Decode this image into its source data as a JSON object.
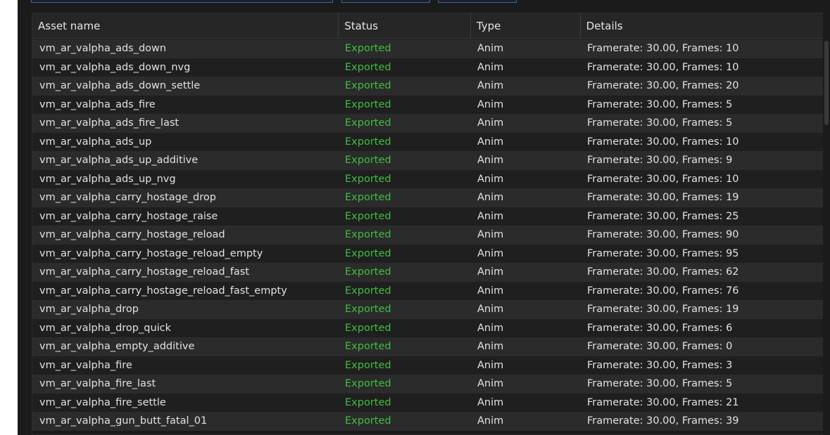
{
  "table": {
    "columns": [
      "Asset name",
      "Status",
      "Type",
      "Details"
    ],
    "rows": [
      {
        "name": "vm_ar_valpha_ads_down",
        "status": "Exported",
        "type": "Anim",
        "details": "Framerate: 30.00, Frames: 10"
      },
      {
        "name": "vm_ar_valpha_ads_down_nvg",
        "status": "Exported",
        "type": "Anim",
        "details": "Framerate: 30.00, Frames: 10"
      },
      {
        "name": "vm_ar_valpha_ads_down_settle",
        "status": "Exported",
        "type": "Anim",
        "details": "Framerate: 30.00, Frames: 20"
      },
      {
        "name": "vm_ar_valpha_ads_fire",
        "status": "Exported",
        "type": "Anim",
        "details": "Framerate: 30.00, Frames: 5"
      },
      {
        "name": "vm_ar_valpha_ads_fire_last",
        "status": "Exported",
        "type": "Anim",
        "details": "Framerate: 30.00, Frames: 5"
      },
      {
        "name": "vm_ar_valpha_ads_up",
        "status": "Exported",
        "type": "Anim",
        "details": "Framerate: 30.00, Frames: 10"
      },
      {
        "name": "vm_ar_valpha_ads_up_additive",
        "status": "Exported",
        "type": "Anim",
        "details": "Framerate: 30.00, Frames: 9"
      },
      {
        "name": "vm_ar_valpha_ads_up_nvg",
        "status": "Exported",
        "type": "Anim",
        "details": "Framerate: 30.00, Frames: 10"
      },
      {
        "name": "vm_ar_valpha_carry_hostage_drop",
        "status": "Exported",
        "type": "Anim",
        "details": "Framerate: 30.00, Frames: 19"
      },
      {
        "name": "vm_ar_valpha_carry_hostage_raise",
        "status": "Exported",
        "type": "Anim",
        "details": "Framerate: 30.00, Frames: 25"
      },
      {
        "name": "vm_ar_valpha_carry_hostage_reload",
        "status": "Exported",
        "type": "Anim",
        "details": "Framerate: 30.00, Frames: 90"
      },
      {
        "name": "vm_ar_valpha_carry_hostage_reload_empty",
        "status": "Exported",
        "type": "Anim",
        "details": "Framerate: 30.00, Frames: 95"
      },
      {
        "name": "vm_ar_valpha_carry_hostage_reload_fast",
        "status": "Exported",
        "type": "Anim",
        "details": "Framerate: 30.00, Frames: 62"
      },
      {
        "name": "vm_ar_valpha_carry_hostage_reload_fast_empty",
        "status": "Exported",
        "type": "Anim",
        "details": "Framerate: 30.00, Frames: 76"
      },
      {
        "name": "vm_ar_valpha_drop",
        "status": "Exported",
        "type": "Anim",
        "details": "Framerate: 30.00, Frames: 19"
      },
      {
        "name": "vm_ar_valpha_drop_quick",
        "status": "Exported",
        "type": "Anim",
        "details": "Framerate: 30.00, Frames: 6"
      },
      {
        "name": "vm_ar_valpha_empty_additive",
        "status": "Exported",
        "type": "Anim",
        "details": "Framerate: 30.00, Frames: 0"
      },
      {
        "name": "vm_ar_valpha_fire",
        "status": "Exported",
        "type": "Anim",
        "details": "Framerate: 30.00, Frames: 3"
      },
      {
        "name": "vm_ar_valpha_fire_last",
        "status": "Exported",
        "type": "Anim",
        "details": "Framerate: 30.00, Frames: 5"
      },
      {
        "name": "vm_ar_valpha_fire_settle",
        "status": "Exported",
        "type": "Anim",
        "details": "Framerate: 30.00, Frames: 21"
      },
      {
        "name": "vm_ar_valpha_gun_butt_fatal_01",
        "status": "Exported",
        "type": "Anim",
        "details": "Framerate: 30.00, Frames: 39"
      }
    ]
  },
  "colors": {
    "status_exported": "#3fbe3f",
    "background": "#1b1b1b",
    "row_alt": "#2b2b2b",
    "accent": "#2a6fb8"
  }
}
